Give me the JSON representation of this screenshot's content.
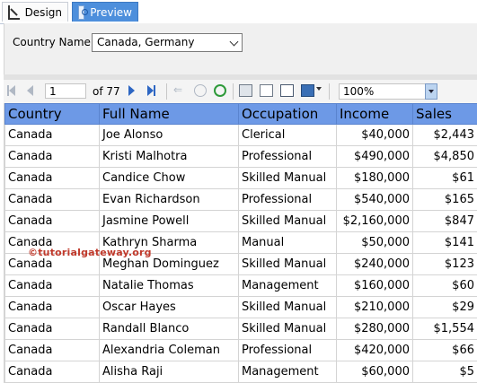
{
  "tabs": [
    {
      "label": "Design",
      "icon": "design-ruler-icon",
      "active": false
    },
    {
      "label": "Preview",
      "icon": "preview-icon",
      "active": true
    }
  ],
  "parameters": {
    "label": "Country Name",
    "value": "Canada, Germany"
  },
  "toolbar": {
    "page_current": "1",
    "page_total_text": "of  77",
    "zoom": "100%",
    "icons": [
      "first-page-icon",
      "prev-page-icon",
      "next-page-icon",
      "last-page-icon",
      "back-icon",
      "stop-icon",
      "refresh-icon",
      "print-icon",
      "print-layout-icon",
      "page-setup-icon",
      "export-icon",
      "zoom-dropdown-icon"
    ]
  },
  "table": {
    "columns": [
      "Country",
      "Full Name",
      "Occupation",
      "Income",
      "Sales"
    ],
    "rows": [
      [
        "Canada",
        "Joe Alonso",
        "Clerical",
        "$40,000",
        "$2,443"
      ],
      [
        "Canada",
        "Kristi Malhotra",
        "Professional",
        "$490,000",
        "$4,850"
      ],
      [
        "Canada",
        "Candice Chow",
        "Skilled Manual",
        "$180,000",
        "$61"
      ],
      [
        "Canada",
        "Evan Richardson",
        "Professional",
        "$540,000",
        "$165"
      ],
      [
        "Canada",
        "Jasmine Powell",
        "Skilled Manual",
        "$2,160,000",
        "$847"
      ],
      [
        "Canada",
        "Kathryn Sharma",
        "Manual",
        "$50,000",
        "$141"
      ],
      [
        "Canada",
        "Meghan Dominguez",
        "Skilled Manual",
        "$240,000",
        "$123"
      ],
      [
        "Canada",
        "Natalie Thomas",
        "Management",
        "$160,000",
        "$60"
      ],
      [
        "Canada",
        "Oscar Hayes",
        "Skilled Manual",
        "$210,000",
        "$29"
      ],
      [
        "Canada",
        "Randall Blanco",
        "Skilled Manual",
        "$280,000",
        "$1,554"
      ],
      [
        "Canada",
        "Alexandria Coleman",
        "Professional",
        "$420,000",
        "$66"
      ],
      [
        "Canada",
        "Alisha Raji",
        "Management",
        "$60,000",
        "$5"
      ]
    ]
  },
  "watermark": "©tutorialgateway.org",
  "colors": {
    "header_bg": "#6d99e6",
    "tab_active_bg": "#4d8fdc",
    "watermark": "#c0392b"
  }
}
